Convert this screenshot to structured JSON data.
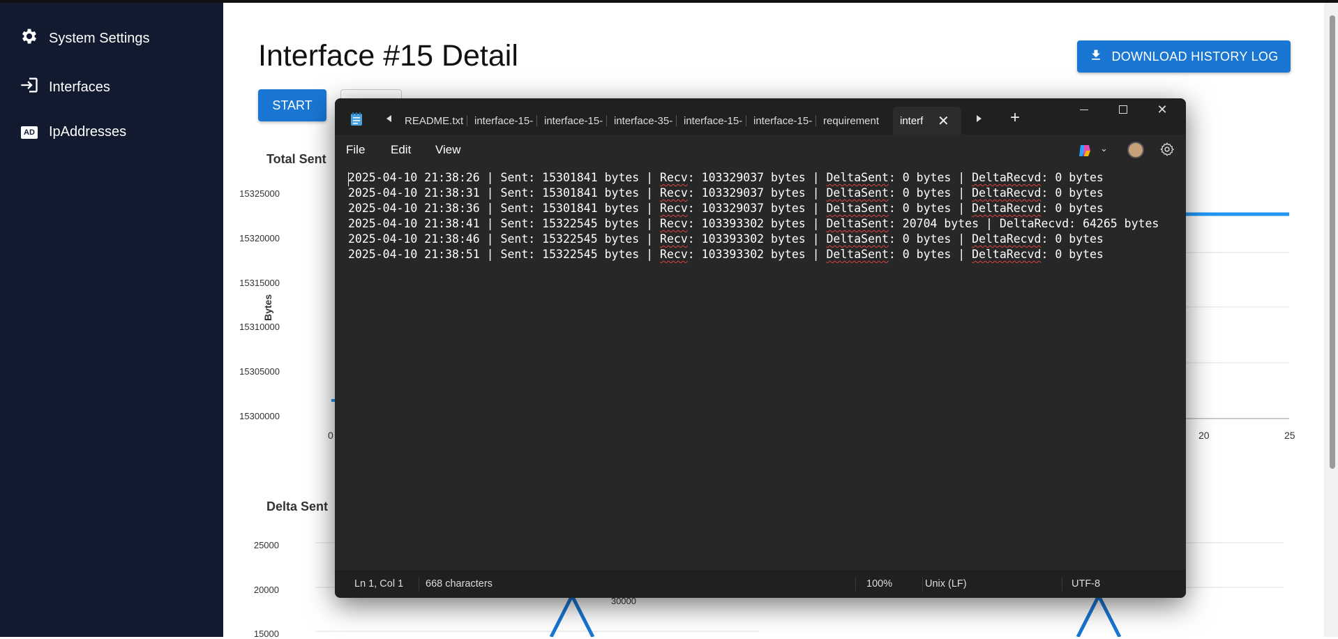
{
  "sidebar": {
    "items": [
      {
        "label": "System Settings",
        "icon": "gear-icon"
      },
      {
        "label": "Interfaces",
        "icon": "login-icon"
      },
      {
        "label": "IpAddresses",
        "icon": "ad-icon",
        "badge": "AD"
      }
    ]
  },
  "main": {
    "title": "Interface #15 Detail",
    "download_label": "DOWNLOAD HISTORY LOG",
    "start_label": "START",
    "chart1": {
      "title": "Total Sent",
      "ylabel": "Bytes",
      "yticks": [
        "15325000",
        "15320000",
        "15315000",
        "15310000",
        "15305000",
        "15300000"
      ],
      "xticks": [
        "0",
        "20",
        "25"
      ]
    },
    "chart2": {
      "title": "Delta Sent",
      "yticks": [
        "25000",
        "20000",
        "15000"
      ],
      "right_partial_tick": "30000"
    }
  },
  "chart_data": [
    {
      "type": "line",
      "title": "Total Sent",
      "ylabel": "Bytes",
      "ylim": [
        15300000,
        15325000
      ],
      "x_visible_ticks": [
        0,
        20,
        25
      ],
      "series": [
        {
          "values_visible": [
            15301841,
            15322545
          ]
        }
      ]
    },
    {
      "type": "line",
      "title": "Delta Sent",
      "yticks_visible": [
        15000,
        20000,
        25000
      ]
    }
  ],
  "notepad": {
    "tabs": [
      "README.txt",
      "interface-15-",
      "interface-15-",
      "interface-35-",
      "interface-15-",
      "interface-15-",
      "requirement",
      "interf"
    ],
    "menu": [
      "File",
      "Edit",
      "View"
    ],
    "lines": [
      {
        "ts": "2025-04-10 21:38:26",
        "sent": "15301841",
        "recv": "103329037",
        "dsent": "0",
        "drecv": "0"
      },
      {
        "ts": "2025-04-10 21:38:31",
        "sent": "15301841",
        "recv": "103329037",
        "dsent": "0",
        "drecv": "0"
      },
      {
        "ts": "2025-04-10 21:38:36",
        "sent": "15301841",
        "recv": "103329037",
        "dsent": "0",
        "drecv": "0"
      },
      {
        "ts": "2025-04-10 21:38:41",
        "sent": "15322545",
        "recv": "103393302",
        "dsent": "20704",
        "drecv": "64265"
      },
      {
        "ts": "2025-04-10 21:38:46",
        "sent": "15322545",
        "recv": "103393302",
        "dsent": "0",
        "drecv": "0"
      },
      {
        "ts": "2025-04-10 21:38:51",
        "sent": "15322545",
        "recv": "103393302",
        "dsent": "0",
        "drecv": "0"
      }
    ],
    "status": {
      "position": "Ln 1, Col 1",
      "chars": "668 characters",
      "zoom": "100%",
      "line_ending": "Unix (LF)",
      "encoding": "UTF-8"
    }
  },
  "colors": {
    "sidebar_bg": "#111a2e",
    "accent": "#1976d2",
    "line": "#2196f3",
    "notepad_bg": "#272727"
  }
}
